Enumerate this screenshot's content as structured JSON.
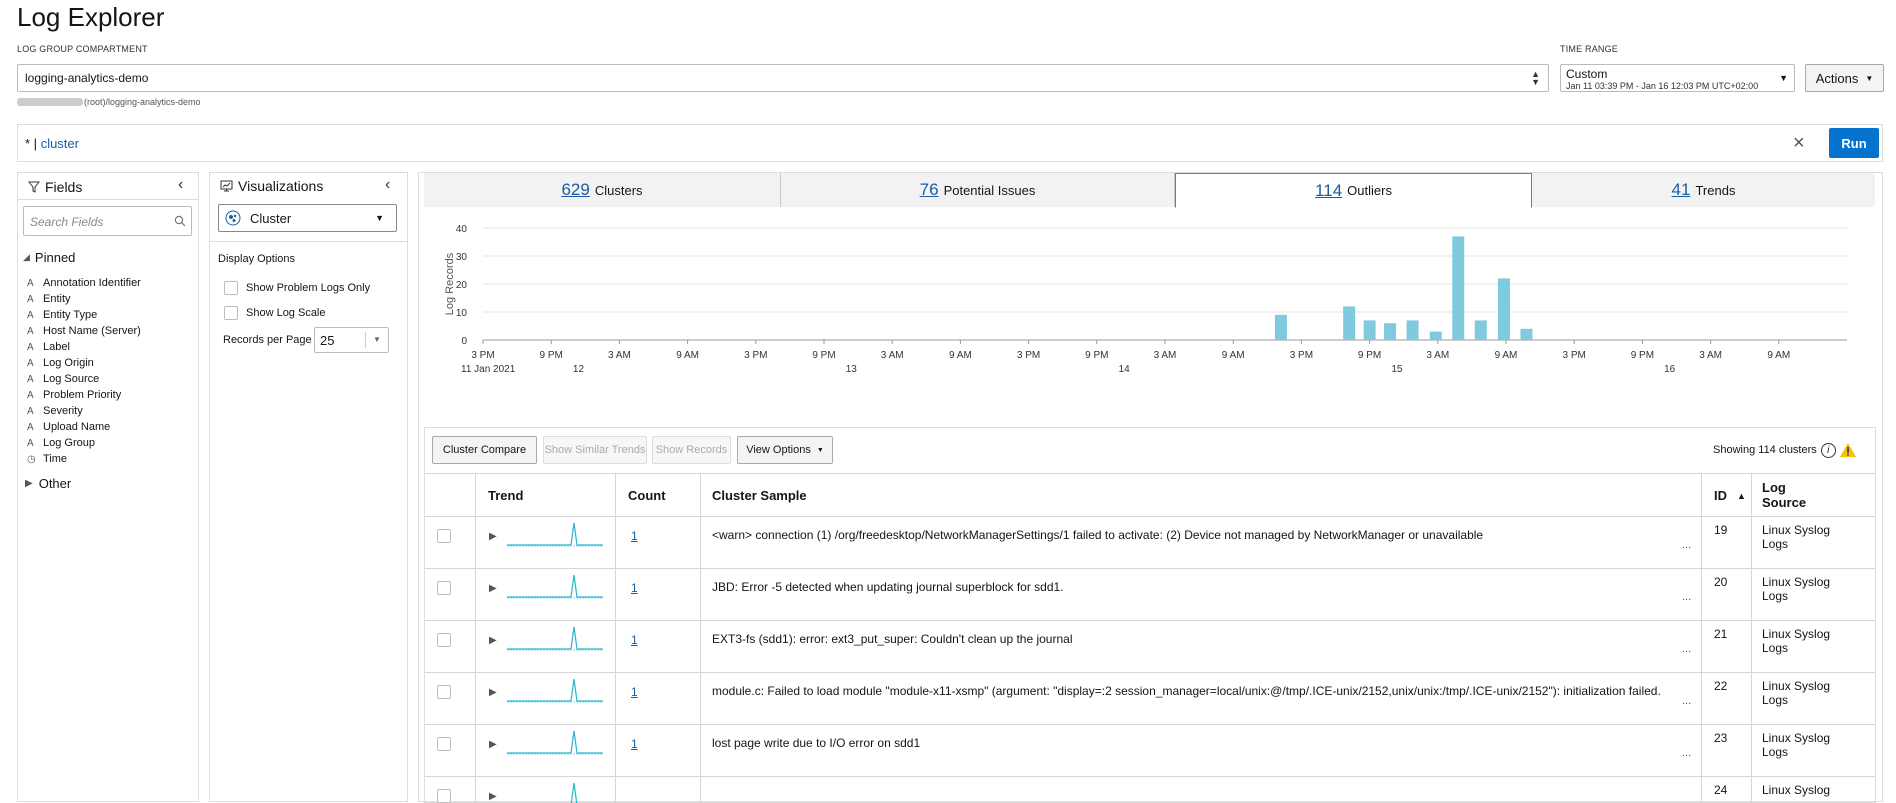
{
  "page": {
    "title": "Log Explorer"
  },
  "compartment": {
    "label": "LOG GROUP COMPARTMENT",
    "value": "logging-analytics-demo",
    "path": "(root)/logging-analytics-demo"
  },
  "time_range": {
    "label": "TIME RANGE",
    "value": "Custom",
    "detail": "Jan 11 03:39 PM - Jan 16 12:03 PM UTC+02:00"
  },
  "actions_label": "Actions",
  "query": {
    "prefix": "* |",
    "keyword": "cluster",
    "run_label": "Run"
  },
  "fields_panel": {
    "title": "Fields",
    "search_placeholder": "Search Fields",
    "pinned_label": "Pinned",
    "other_label": "Other",
    "pinned": [
      {
        "type": "A",
        "name": "Annotation Identifier"
      },
      {
        "type": "A",
        "name": "Entity"
      },
      {
        "type": "A",
        "name": "Entity Type"
      },
      {
        "type": "A",
        "name": "Host Name (Server)"
      },
      {
        "type": "A",
        "name": "Label"
      },
      {
        "type": "A",
        "name": "Log Origin"
      },
      {
        "type": "A",
        "name": "Log Source"
      },
      {
        "type": "A",
        "name": "Problem Priority"
      },
      {
        "type": "A",
        "name": "Severity"
      },
      {
        "type": "A",
        "name": "Upload Name"
      },
      {
        "type": "A",
        "name": "Log Group"
      },
      {
        "type": "clock",
        "name": "Time"
      }
    ]
  },
  "viz_panel": {
    "title": "Visualizations",
    "selected": "Cluster",
    "display_options_label": "Display Options",
    "show_problem_logs": "Show Problem Logs Only",
    "show_log_scale": "Show Log Scale",
    "records_per_page_label": "Records per Page",
    "records_per_page": "25"
  },
  "tabs": [
    {
      "count": "629",
      "label": "Clusters"
    },
    {
      "count": "76",
      "label": "Potential Issues"
    },
    {
      "count": "114",
      "label": "Outliers"
    },
    {
      "count": "41",
      "label": "Trends"
    }
  ],
  "chart_data": {
    "type": "bar",
    "ylabel": "Log Records",
    "ylim": [
      0,
      40
    ],
    "yticks": [
      0,
      10,
      20,
      30,
      40
    ],
    "xticks": [
      "3 PM",
      "9 PM",
      "3 AM",
      "9 AM",
      "3 PM",
      "9 PM",
      "3 AM",
      "9 AM",
      "3 PM",
      "9 PM",
      "3 AM",
      "9 AM",
      "3 PM",
      "9 PM",
      "3 AM",
      "9 AM",
      "3 PM",
      "9 PM",
      "3 AM",
      "9 AM"
    ],
    "xsub": [
      {
        "label": "11 Jan 2021",
        "at": 0
      },
      {
        "label": "12",
        "at": 1.4
      },
      {
        "label": "13",
        "at": 5.4
      },
      {
        "label": "14",
        "at": 9.4
      },
      {
        "label": "15",
        "at": 13.4
      },
      {
        "label": "16",
        "at": 17.4
      }
    ],
    "bars": [
      {
        "x": 11.7,
        "y": 9
      },
      {
        "x": 12.7,
        "y": 12
      },
      {
        "x": 13.0,
        "y": 7
      },
      {
        "x": 13.3,
        "y": 6
      },
      {
        "x": 13.63,
        "y": 7
      },
      {
        "x": 13.97,
        "y": 3
      },
      {
        "x": 14.3,
        "y": 37
      },
      {
        "x": 14.63,
        "y": 7
      },
      {
        "x": 14.97,
        "y": 22
      },
      {
        "x": 15.3,
        "y": 4
      }
    ],
    "color": "#7fcadf",
    "grid": true
  },
  "toolbar": {
    "cluster_compare": "Cluster Compare",
    "show_similar_trends": "Show Similar Trends",
    "show_records": "Show Records",
    "view_options": "View Options",
    "showing_prefix": "Showing",
    "showing_count": "114",
    "showing_suffix": "clusters"
  },
  "table": {
    "headers": {
      "trend": "Trend",
      "count": "Count",
      "sample": "Cluster Sample",
      "id": "ID",
      "log_source": "Log Source"
    },
    "rows": [
      {
        "count": "1",
        "sample": "<warn> connection (1) /org/freedesktop/NetworkManagerSettings/1 failed to activate: (2) Device not managed by NetworkManager or unavailable",
        "id": "19",
        "source": "Linux Syslog Logs"
      },
      {
        "count": "1",
        "sample": "JBD: Error -5 detected when updating journal superblock for sdd1.",
        "id": "20",
        "source": "Linux Syslog Logs"
      },
      {
        "count": "1",
        "sample": "EXT3-fs (sdd1): error: ext3_put_super: Couldn't clean up the journal",
        "id": "21",
        "source": "Linux Syslog Logs"
      },
      {
        "count": "1",
        "sample": "module.c: Failed to load  module \"module-x11-xsmp\" (argument: \"display=:2 session_manager=local/unix:@/tmp/.ICE-unix/2152,unix/unix:/tmp/.ICE-unix/2152\"): initialization failed.",
        "id": "22",
        "source": "Linux Syslog Logs"
      },
      {
        "count": "1",
        "sample": "lost page write due to I/O error on sdd1",
        "id": "23",
        "source": "Linux Syslog Logs"
      },
      {
        "count": "",
        "sample": "",
        "id": "24",
        "source": "Linux Syslog"
      }
    ]
  }
}
